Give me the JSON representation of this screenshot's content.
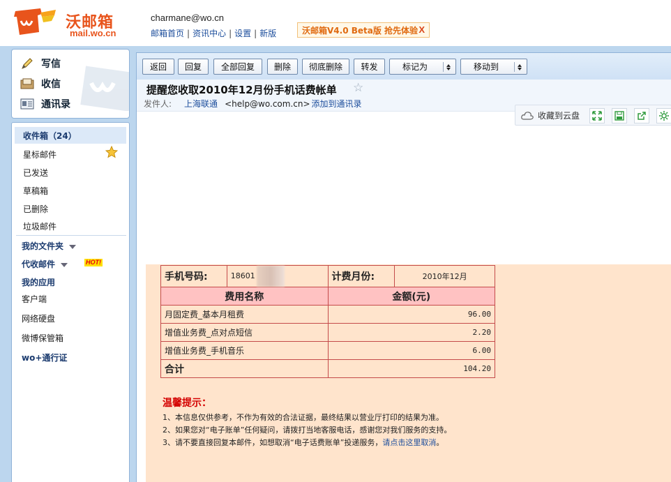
{
  "header": {
    "logo_text": "沃邮箱",
    "logo_url": "mail.wo.cn",
    "user_email": "charmane@wo.cn",
    "links": [
      "邮箱首页",
      "资讯中心",
      "设置",
      "新版"
    ],
    "beta_text": "沃邮箱V4.0 Beta版 抢先体验",
    "beta_close": "X"
  },
  "sidebar": {
    "quick": [
      {
        "label": "写信",
        "icon": "pencil-icon"
      },
      {
        "label": "收信",
        "icon": "inbox-tray-icon"
      },
      {
        "label": "通讯录",
        "icon": "address-book-icon"
      }
    ],
    "folders": [
      {
        "label": "收件箱",
        "count": "（24）"
      },
      {
        "label": "星标邮件"
      },
      {
        "label": "已发送"
      },
      {
        "label": "草稿箱"
      },
      {
        "label": "已删除"
      },
      {
        "label": "垃圾邮件"
      }
    ],
    "my_folders": "我的文件夹",
    "collect_mail": "代收邮件",
    "hot_badge": "HOT!",
    "my_apps": "我的应用",
    "apps": [
      "客户端",
      "网络硬盘",
      "微博保管箱"
    ],
    "wo_pass": "wo+通行证"
  },
  "toolbar": {
    "back": "返回",
    "reply": "回复",
    "reply_all": "全部回复",
    "delete": "删除",
    "delete_permanently": "彻底删除",
    "forward": "转发",
    "mark_as": "标记为",
    "move_to": "移动到"
  },
  "mail": {
    "subject": "提醒您收取2010年12月份手机话费帐单",
    "sender_label": "发件人:",
    "sender_name": "上海联通",
    "sender_addr": "<help@wo.com.cn>",
    "add_contact": "添加到通讯录"
  },
  "actions": {
    "save_cloud": "收藏到云盘"
  },
  "bill": {
    "phone_label": "手机号码:",
    "phone_value": "18601",
    "month_label": "计费月份:",
    "month_value": "2010年12月",
    "col_name": "费用名称",
    "col_amount": "金额(元)",
    "rows": [
      {
        "name": "月固定费_基本月租费",
        "amount": "96.00"
      },
      {
        "name": "增值业务费_点对点短信",
        "amount": "2.20"
      },
      {
        "name": "增值业务费_手机音乐",
        "amount": "6.00"
      }
    ],
    "total_label": "合计",
    "total_value": "104.20"
  },
  "tips": {
    "title": "温馨提示：",
    "line1": "1、本信息仅供参考，不作为有效的合法证据，最终结果以营业厅打印的结果为准。",
    "line2": "2、如果您对“电子账单”任何疑问，请拨打当地客服电话，感谢您对我们服务的支持。",
    "line3_prefix": "3、请不要直接回复本邮件，如想取消“电子话费账单”投递服务，",
    "line3_link": "请点击这里取消",
    "line3_suffix": "。"
  },
  "colors": {
    "brand": "#e8541c",
    "frame": "#bcd6ee",
    "bill_bg": "#ffe4cc",
    "bill_header": "#ffc2c2",
    "tip_title": "#d40000",
    "link": "#1d4e9c"
  }
}
